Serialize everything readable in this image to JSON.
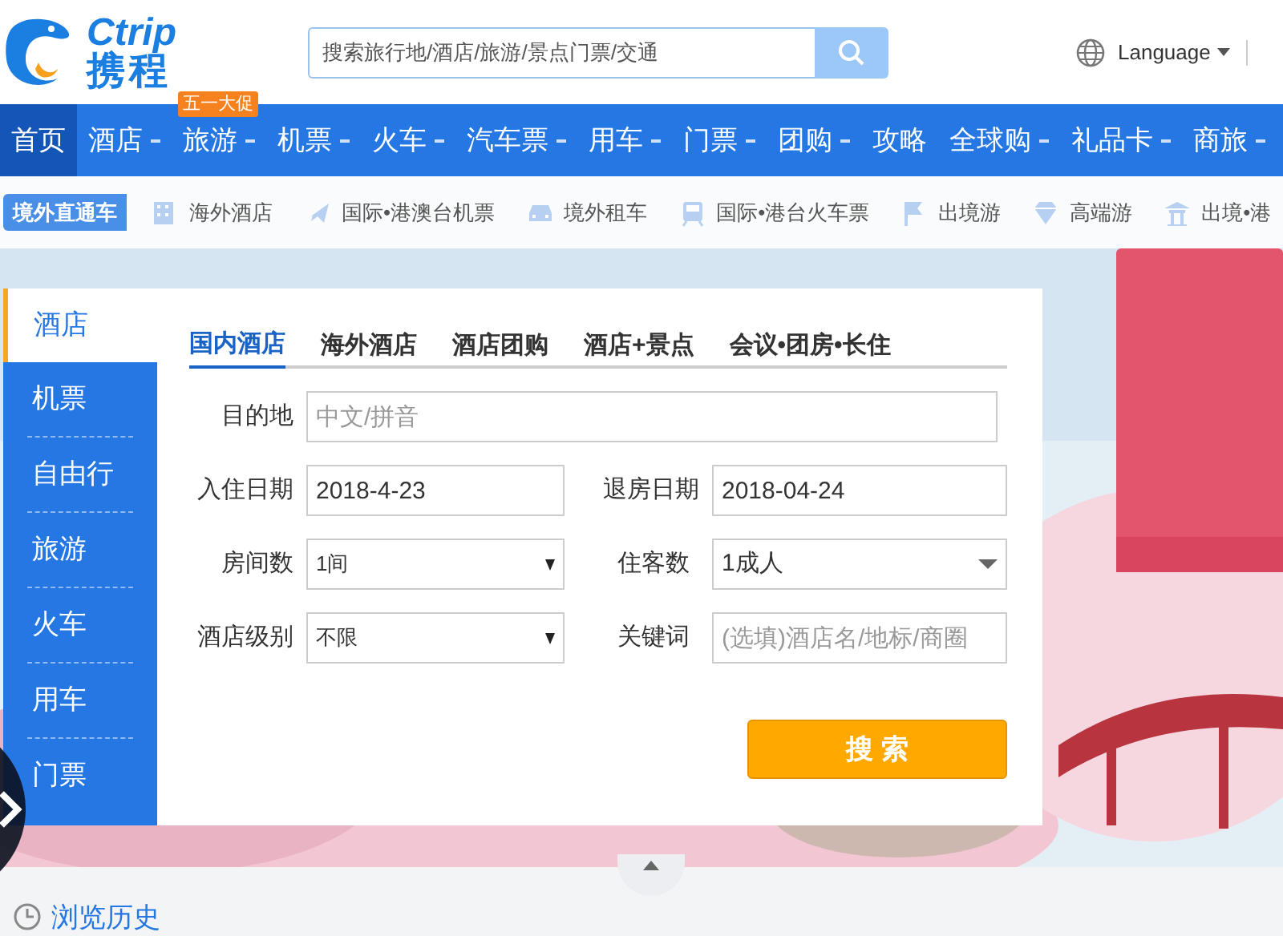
{
  "header": {
    "logo": {
      "latin": "Ctrip",
      "chinese": "携程"
    },
    "search": {
      "placeholder": "搜索旅行地/酒店/旅游/景点门票/交通"
    },
    "language": "Language"
  },
  "nav": [
    {
      "label": "首页",
      "selected": true,
      "dropdown": false
    },
    {
      "label": "酒店",
      "selected": false,
      "dropdown": true
    },
    {
      "label": "旅游",
      "selected": false,
      "dropdown": true,
      "badge": "五一大促"
    },
    {
      "label": "机票",
      "selected": false,
      "dropdown": true
    },
    {
      "label": "火车",
      "selected": false,
      "dropdown": true
    },
    {
      "label": "汽车票",
      "selected": false,
      "dropdown": true
    },
    {
      "label": "用车",
      "selected": false,
      "dropdown": true
    },
    {
      "label": "门票",
      "selected": false,
      "dropdown": true
    },
    {
      "label": "团购",
      "selected": false,
      "dropdown": true
    },
    {
      "label": "攻略",
      "selected": false,
      "dropdown": false
    },
    {
      "label": "全球购",
      "selected": false,
      "dropdown": true
    },
    {
      "label": "礼品卡",
      "selected": false,
      "dropdown": true
    },
    {
      "label": "商旅",
      "selected": false,
      "dropdown": true
    }
  ],
  "subnav": {
    "tag": "境外直通车",
    "items": [
      {
        "label": "海外酒店",
        "kind": "building"
      },
      {
        "label": "国际•港澳台机票",
        "kind": "plane"
      },
      {
        "label": "境外租车",
        "kind": "car"
      },
      {
        "label": "国际•港台火车票",
        "kind": "train"
      },
      {
        "label": "出境游",
        "kind": "flag"
      },
      {
        "label": "高端游",
        "kind": "diamond"
      },
      {
        "label": "出境•港",
        "kind": "temple"
      }
    ]
  },
  "side_tabs": [
    {
      "label": "酒店",
      "selected": true
    },
    {
      "label": "机票",
      "selected": false
    },
    {
      "label": "自由行",
      "selected": false
    },
    {
      "label": "旅游",
      "selected": false
    },
    {
      "label": "火车",
      "selected": false
    },
    {
      "label": "用车",
      "selected": false
    },
    {
      "label": "门票",
      "selected": false
    }
  ],
  "hotel_tabs": [
    {
      "label": "国内酒店",
      "selected": true
    },
    {
      "label": "海外酒店",
      "selected": false
    },
    {
      "label": "酒店团购",
      "selected": false
    },
    {
      "label": "酒店+景点",
      "selected": false
    },
    {
      "label": "会议•团房•长住",
      "selected": false
    }
  ],
  "form": {
    "destination": {
      "label": "目的地",
      "placeholder": "中文/拼音"
    },
    "checkin": {
      "label": "入住日期",
      "value": "2018-4-23"
    },
    "checkout": {
      "label": "退房日期",
      "value": "2018-04-24"
    },
    "rooms": {
      "label": "房间数",
      "value": "1间"
    },
    "guests": {
      "label": "住客数",
      "value": "1成人"
    },
    "star": {
      "label": "酒店级别",
      "value": "不限"
    },
    "keyword": {
      "label": "关键词",
      "placeholder": "(选填)酒店名/地标/商圈"
    },
    "search_button": "搜 索"
  },
  "history": "浏览历史"
}
